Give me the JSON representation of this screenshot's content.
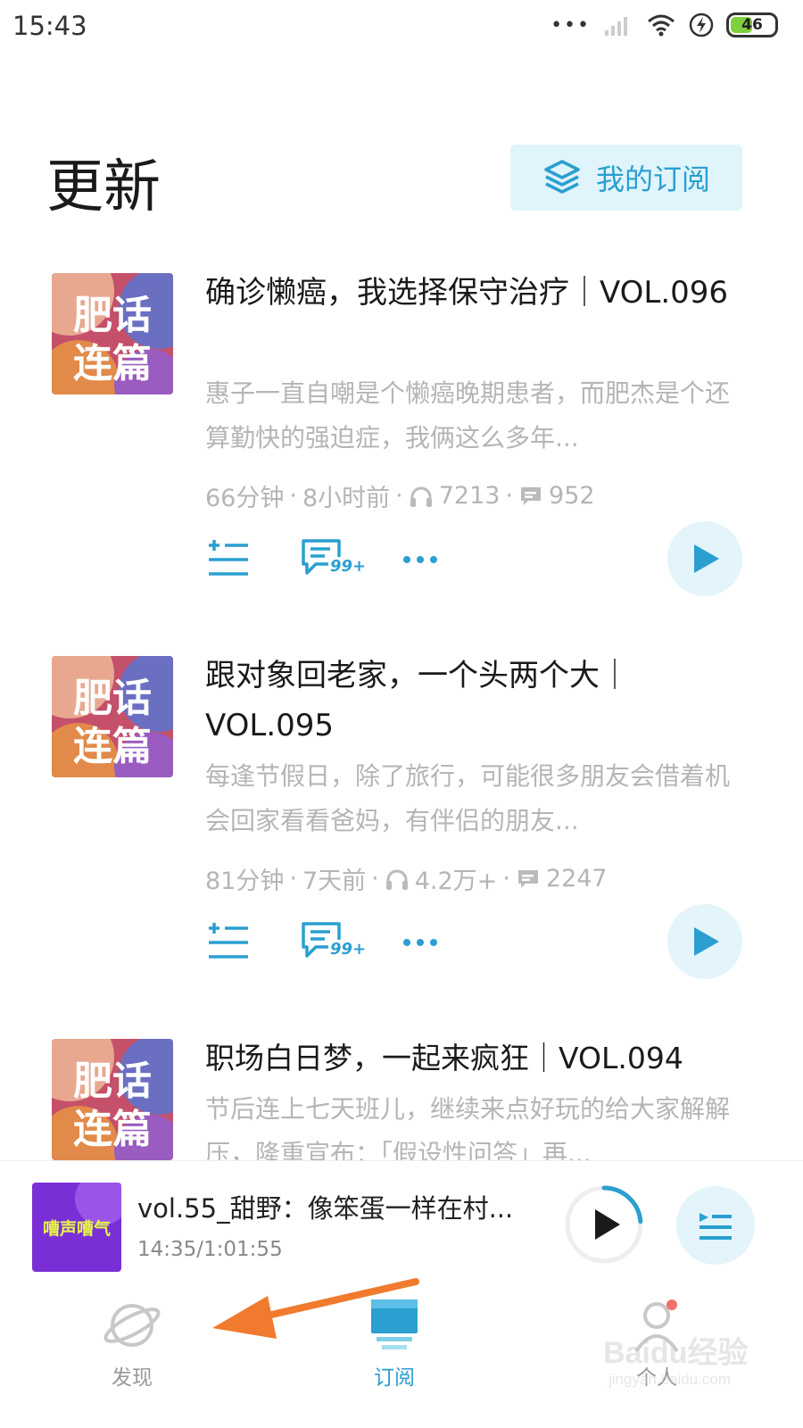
{
  "status_bar": {
    "time": "15:43",
    "battery": "46",
    "dots": "•••"
  },
  "header": {
    "title": "更新",
    "my_subscriptions_label": "我的订阅"
  },
  "cover_art": {
    "line1": "肥话",
    "line2": "连篇"
  },
  "episodes": [
    {
      "title": "确诊懒癌，我选择保守治疗｜VOL.096",
      "desc": "惠子一直自嘲是个懒癌晚期患者，而肥杰是个还算勤快的强迫症，我俩这么多年...",
      "duration": "66分钟",
      "age": "8小时前",
      "plays": "7213",
      "comments": "952",
      "comment_badge": "99+"
    },
    {
      "title": "跟对象回老家，一个头两个大｜VOL.095",
      "desc": "每逢节假日，除了旅行，可能很多朋友会借着机会回家看看爸妈，有伴侣的朋友...",
      "duration": "81分钟",
      "age": "7天前",
      "plays": "4.2万+",
      "comments": "2247",
      "comment_badge": "99+"
    },
    {
      "title": "职场白日梦，一起来疯狂｜VOL.094",
      "desc": "节后连上七天班儿，继续来点好玩的给大家解解压，隆重宣布：「假设性问答」再..."
    }
  ],
  "mini_player": {
    "cover_text": "嘈声嘈气",
    "title": "vol.55_甜野：像笨蛋一样在村...",
    "time": "14:35/1:01:55",
    "progress": 0.236
  },
  "tabs": [
    {
      "label": "发现",
      "active": false
    },
    {
      "label": "订阅",
      "active": true
    },
    {
      "label": "个人",
      "active": false
    }
  ],
  "watermark": {
    "brand": "Baidu经验",
    "url": "jingyan.baidu.com"
  },
  "colors": {
    "accent": "#2a9fd0",
    "accent_light": "#e3f4fa",
    "muted": "#b5b5b5",
    "arrow": "#f07a2e"
  }
}
